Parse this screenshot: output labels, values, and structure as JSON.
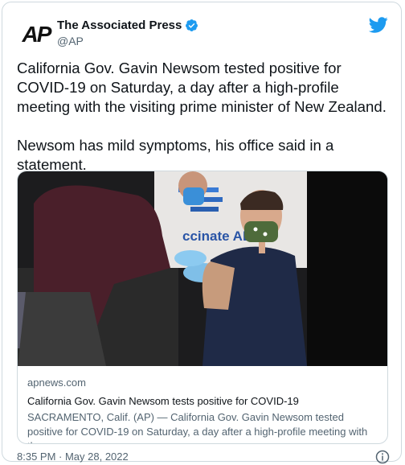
{
  "author": {
    "display_name": "The Associated Press",
    "handle": "@AP",
    "avatar_text": "AP"
  },
  "tweet": {
    "text": "California Gov. Gavin Newsom tested positive for COVID-19 on Saturday, a day after a high-profile meeting with the visiting prime minister of New Zealand.\n\nNewsom has mild symptoms, his office said in a statement."
  },
  "link_card": {
    "photo_sign_text": "ccinate ALL 5",
    "domain": "apnews.com",
    "title": "California Gov. Gavin Newsom tests positive for COVID-19",
    "description": "SACRAMENTO, Calif. (AP) — California Gov. Gavin Newsom tested positive for COVID-19 on Saturday, a day after a high-profile meeting with the ..."
  },
  "footer": {
    "timestamp": "8:35 PM · May 28, 2022"
  },
  "colors": {
    "twitter_blue": "#1d9bf0",
    "text_primary": "#0f1419",
    "text_secondary": "#536471",
    "border": "#cfd9de"
  },
  "icons": [
    "verified-badge-icon",
    "twitter-bird-icon",
    "info-icon"
  ]
}
